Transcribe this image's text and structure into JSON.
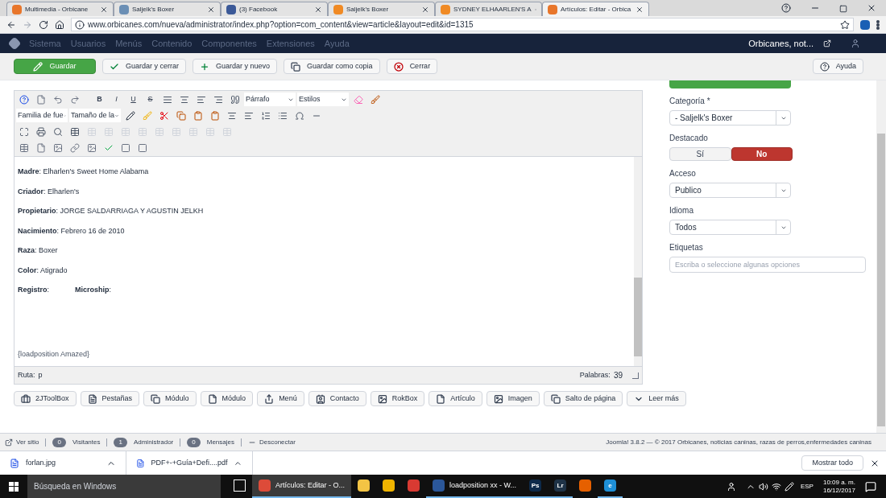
{
  "browser": {
    "tabs": [
      {
        "title": "Multimedia - Orbicane",
        "kind": "joomla",
        "selected": false
      },
      {
        "title": "Saljelk's Boxer",
        "kind": "dog",
        "selected": false
      },
      {
        "title": "(3) Facebook",
        "kind": "facebook",
        "selected": false
      },
      {
        "title": "Saljelk's Boxer",
        "kind": "orange",
        "selected": false
      },
      {
        "title": "SYDNEY ELHAARLEN'S A",
        "kind": "orange",
        "selected": false
      },
      {
        "title": "Artículos: Editar - Orbica",
        "kind": "joomla",
        "selected": true
      }
    ],
    "url": "www.orbicanes.com/nueva/administrator/index.php?option=com_content&view=article&layout=edit&id=1315"
  },
  "nav": {
    "items": [
      "Sistema",
      "Usuarios",
      "Menús",
      "Contenido",
      "Componentes",
      "Extensiones",
      "Ayuda"
    ],
    "site": "Orbicanes, not..."
  },
  "toolbar": {
    "buttons": [
      {
        "label": "Guardar",
        "kind": "save"
      },
      {
        "label": "Guardar y cerrar",
        "kind": "check"
      },
      {
        "label": "Guardar y nuevo",
        "kind": "plus"
      },
      {
        "label": "Guardar como copia",
        "kind": "copy"
      },
      {
        "label": "Cerrar",
        "kind": "close"
      }
    ],
    "help": "Ayuda"
  },
  "editor": {
    "marks": [
      "B",
      "I",
      "U",
      "S"
    ],
    "format": "Párrafo",
    "styles": "Estilos",
    "font_family": "Familia de fue",
    "font_size": "Tamaño de la",
    "lines": [
      {
        "parts": [
          "**Madre**: Elharlen's Sweet Home Alabama"
        ]
      },
      {
        "parts": [
          "**Criador**: Elharlen's"
        ]
      },
      {
        "parts": [
          "**Propietario**: JORGE SALDARRIAGA Y AGUSTIN JELKH"
        ]
      },
      {
        "parts": [
          "**Nacimiento**: Febrero 16 de 2010"
        ]
      },
      {
        "parts": [
          "**Raza**: Boxer"
        ]
      },
      {
        "parts": [
          "**Color**: Atigrado"
        ]
      },
      {
        "parts": [
          "**Registro**:",
          "**Microship**:"
        ]
      }
    ],
    "loadposition": "{loadposition Amazed}",
    "path_label": "Ruta:",
    "path": "p",
    "words_label": "Palabras:",
    "words": "39"
  },
  "insert_buttons": [
    {
      "label": "2JToolBox",
      "kind": "briefcase"
    },
    {
      "label": "Pestañas",
      "kind": "list"
    },
    {
      "label": "Módulo",
      "kind": "copy"
    },
    {
      "label": "Módulo",
      "kind": "file"
    },
    {
      "label": "Menú",
      "kind": "share"
    },
    {
      "label": "Contacto",
      "kind": "contact"
    },
    {
      "label": "RokBox",
      "kind": "picture"
    },
    {
      "label": "Artículo",
      "kind": "file"
    },
    {
      "label": "Imagen",
      "kind": "image"
    },
    {
      "label": "Salto de página",
      "kind": "copy"
    },
    {
      "label": "Leer más",
      "kind": "chevron"
    }
  ],
  "sidebar": {
    "category": {
      "label": "Categoría *",
      "value": "- Saljelk's Boxer"
    },
    "featured": {
      "label": "Destacado",
      "options": [
        {
          "label": "Sí",
          "selected": false
        },
        {
          "label": "No",
          "selected": true
        }
      ]
    },
    "access": {
      "label": "Acceso",
      "value": "Publico"
    },
    "language": {
      "label": "Idioma",
      "value": "Todos"
    },
    "tags": {
      "label": "Etiquetas",
      "placeholder": "Escriba o seleccione algunas opciones"
    }
  },
  "status": {
    "view_site": "Ver sitio",
    "counters": [
      {
        "count": "0",
        "label": "Visitantes"
      },
      {
        "count": "1",
        "label": "Administrador"
      },
      {
        "count": "0",
        "label": "Mensajes"
      }
    ],
    "logout": "Desconectar",
    "copyright": "Joomla! 3.8.2 — © 2017 Orbicanes, noticias caninas, razas de perros,enfermedades caninas"
  },
  "downloads": {
    "files": [
      {
        "name": "forlan.jpg"
      },
      {
        "name": "PDF+-+Guía+Defi....pdf"
      }
    ],
    "show_all": "Mostrar todo"
  },
  "taskbar": {
    "search": "Búsqueda en Windows",
    "apps": [
      {
        "kind": "taskview",
        "active": false
      },
      {
        "kind": "chrome",
        "label": "Artículos: Editar - O...",
        "active": true
      },
      {
        "kind": "folder",
        "active": false
      },
      {
        "kind": "yellow",
        "active": false
      },
      {
        "kind": "red",
        "active": false
      },
      {
        "kind": "word",
        "label": "loadposition xx - W...",
        "active": false
      },
      {
        "kind": "ps",
        "label": "Ps",
        "active": false
      },
      {
        "kind": "lr",
        "label": "Lr",
        "active": false
      },
      {
        "kind": "firefox",
        "active": false
      },
      {
        "kind": "ie",
        "label": "e",
        "active": false
      }
    ],
    "lang": "ESP",
    "time": "10:09 a. m.",
    "date": "16/12/2017"
  }
}
